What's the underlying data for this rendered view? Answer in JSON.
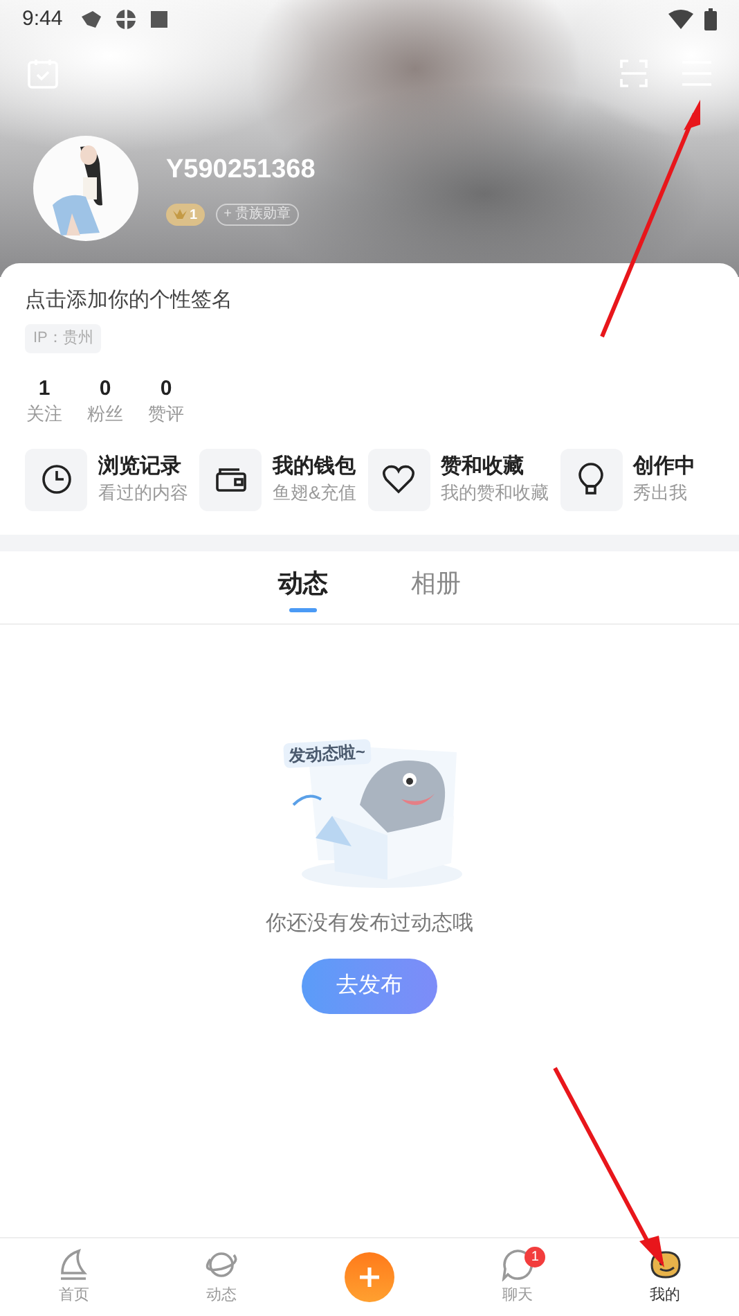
{
  "status_bar": {
    "time": "9:44"
  },
  "profile": {
    "username": "Y590251368",
    "level_badge": "1",
    "medal_button": "+ 贵族勋章",
    "signature_placeholder": "点击添加你的个性签名",
    "ip_tag": "IP：贵州"
  },
  "stats": [
    {
      "value": "1",
      "label": "关注"
    },
    {
      "value": "0",
      "label": "粉丝"
    },
    {
      "value": "0",
      "label": "赞评"
    }
  ],
  "shortcuts": [
    {
      "kind": "clock",
      "title": "浏览记录",
      "subtitle": "看过的内容"
    },
    {
      "kind": "wallet",
      "title": "我的钱包",
      "subtitle": "鱼翅&充值"
    },
    {
      "kind": "heart",
      "title": "赞和收藏",
      "subtitle": "我的赞和收藏"
    },
    {
      "kind": "bulb",
      "title": "创作中",
      "subtitle": "秀出我"
    }
  ],
  "tabs": [
    {
      "label": "动态",
      "selected": true
    },
    {
      "label": "相册",
      "selected": false
    }
  ],
  "empty_state": {
    "illustration_label": "发动态啦~",
    "message": "你还没有发布过动态哦",
    "button": "去发布"
  },
  "bottom_nav": [
    {
      "kind": "home",
      "label": "首页",
      "selected": false
    },
    {
      "kind": "planet",
      "label": "动态",
      "selected": false
    },
    {
      "kind": "plus"
    },
    {
      "kind": "chat",
      "label": "聊天",
      "badge": "1",
      "selected": false
    },
    {
      "kind": "me",
      "label": "我的",
      "selected": true
    }
  ]
}
